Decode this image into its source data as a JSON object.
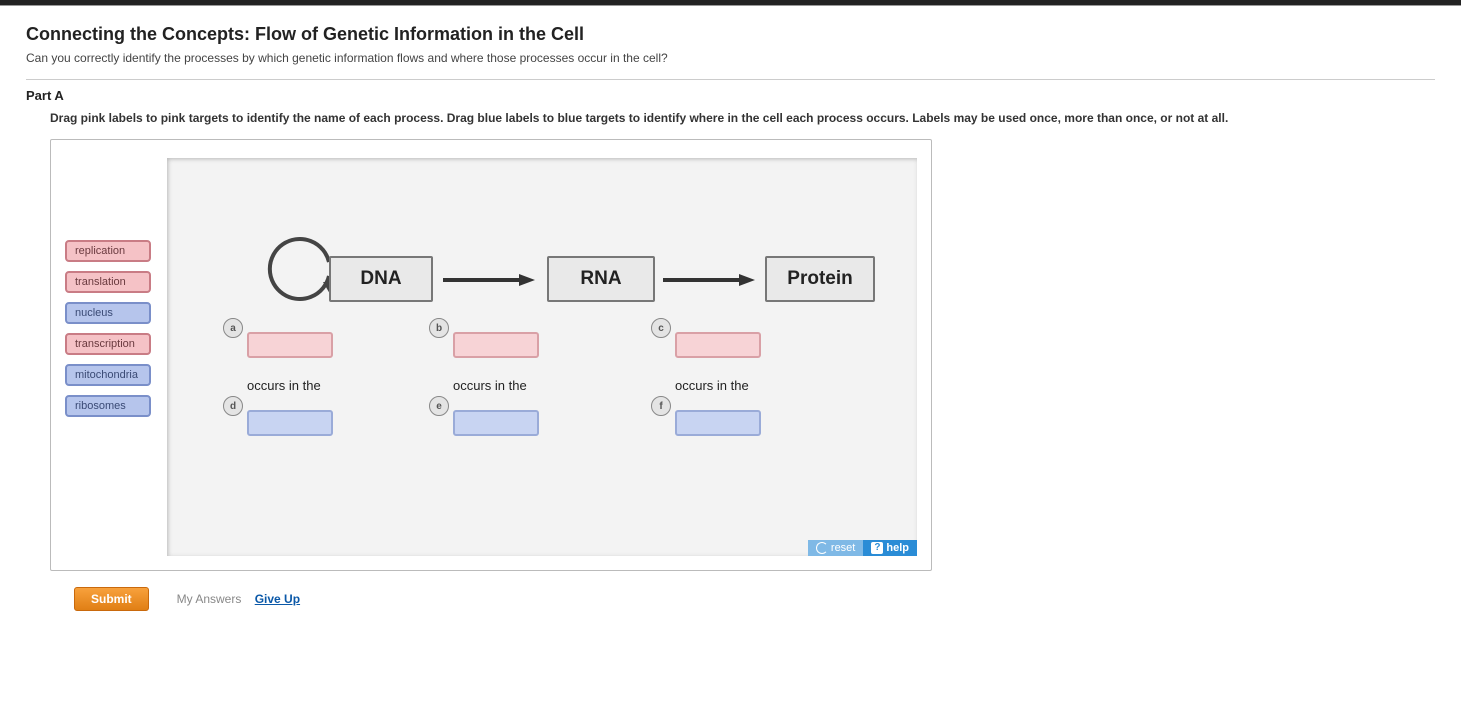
{
  "header": {
    "title": "Connecting the Concepts: Flow of Genetic Information in the Cell",
    "subtitle": "Can you correctly identify the processes by which genetic information flows and where those processes occur in the cell?"
  },
  "part": {
    "label": "Part A",
    "instructions": "Drag pink labels to pink targets to identify the name of each process. Drag blue labels to blue targets to identify where in the cell each process occurs. Labels may be used once, more than once, or not at all."
  },
  "palette": {
    "items": [
      {
        "text": "replication",
        "color": "pink"
      },
      {
        "text": "translation",
        "color": "pink"
      },
      {
        "text": "nucleus",
        "color": "blue"
      },
      {
        "text": "transcription",
        "color": "pink"
      },
      {
        "text": "mitochondria",
        "color": "blue"
      },
      {
        "text": "ribosomes",
        "color": "blue"
      }
    ]
  },
  "flow": {
    "boxDNA": "DNA",
    "boxRNA": "RNA",
    "boxProtein": "Protein",
    "occursText": "occurs in the"
  },
  "markers": {
    "a": "a",
    "b": "b",
    "c": "c",
    "d": "d",
    "e": "e",
    "f": "f"
  },
  "controls": {
    "reset": "reset",
    "help": "help"
  },
  "footer": {
    "submit": "Submit",
    "myAnswers": "My Answers",
    "giveUp": "Give Up"
  }
}
